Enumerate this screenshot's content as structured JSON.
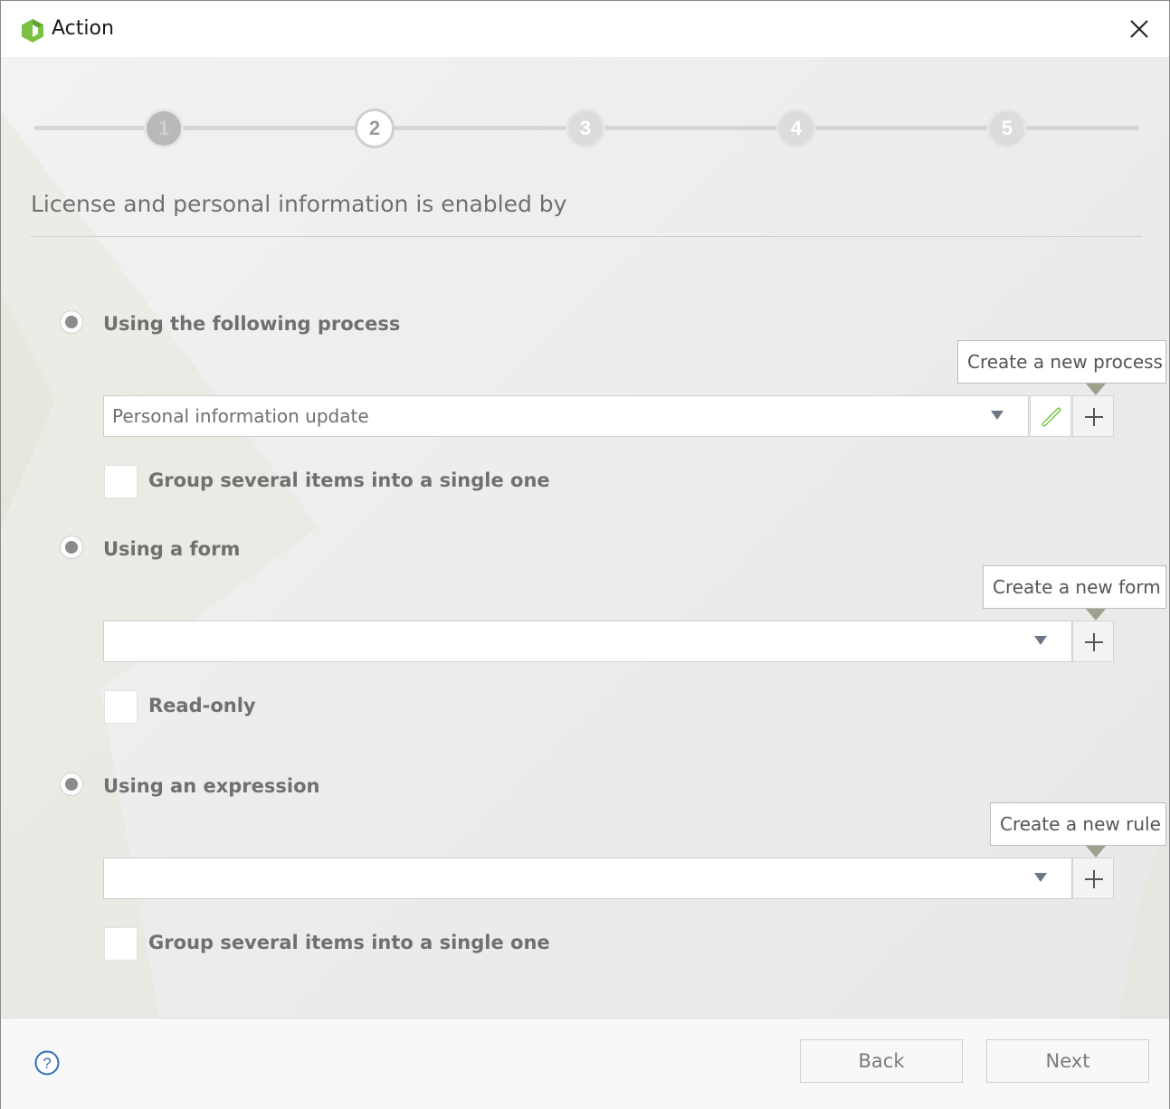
{
  "window": {
    "title": "Action"
  },
  "stepper": {
    "steps": [
      "1",
      "2",
      "3",
      "4",
      "5"
    ],
    "current": 2
  },
  "heading": "License and personal information is enabled by",
  "options": {
    "process": {
      "label": "Using the following process",
      "selected_value": "Personal information update",
      "tooltip": "Create a new process",
      "checkbox_label": "Group several items into a single one"
    },
    "form": {
      "label": "Using a form",
      "selected_value": "",
      "tooltip": "Create a new form",
      "checkbox_label": "Read-only"
    },
    "expression": {
      "label": "Using an expression",
      "selected_value": "",
      "tooltip": "Create a new rule",
      "checkbox_label": "Group several items into a single one"
    }
  },
  "footer": {
    "back_label": "Back",
    "next_label": "Next"
  },
  "colors": {
    "brand_green": "#7cc242",
    "help_blue": "#2f6fb8"
  }
}
